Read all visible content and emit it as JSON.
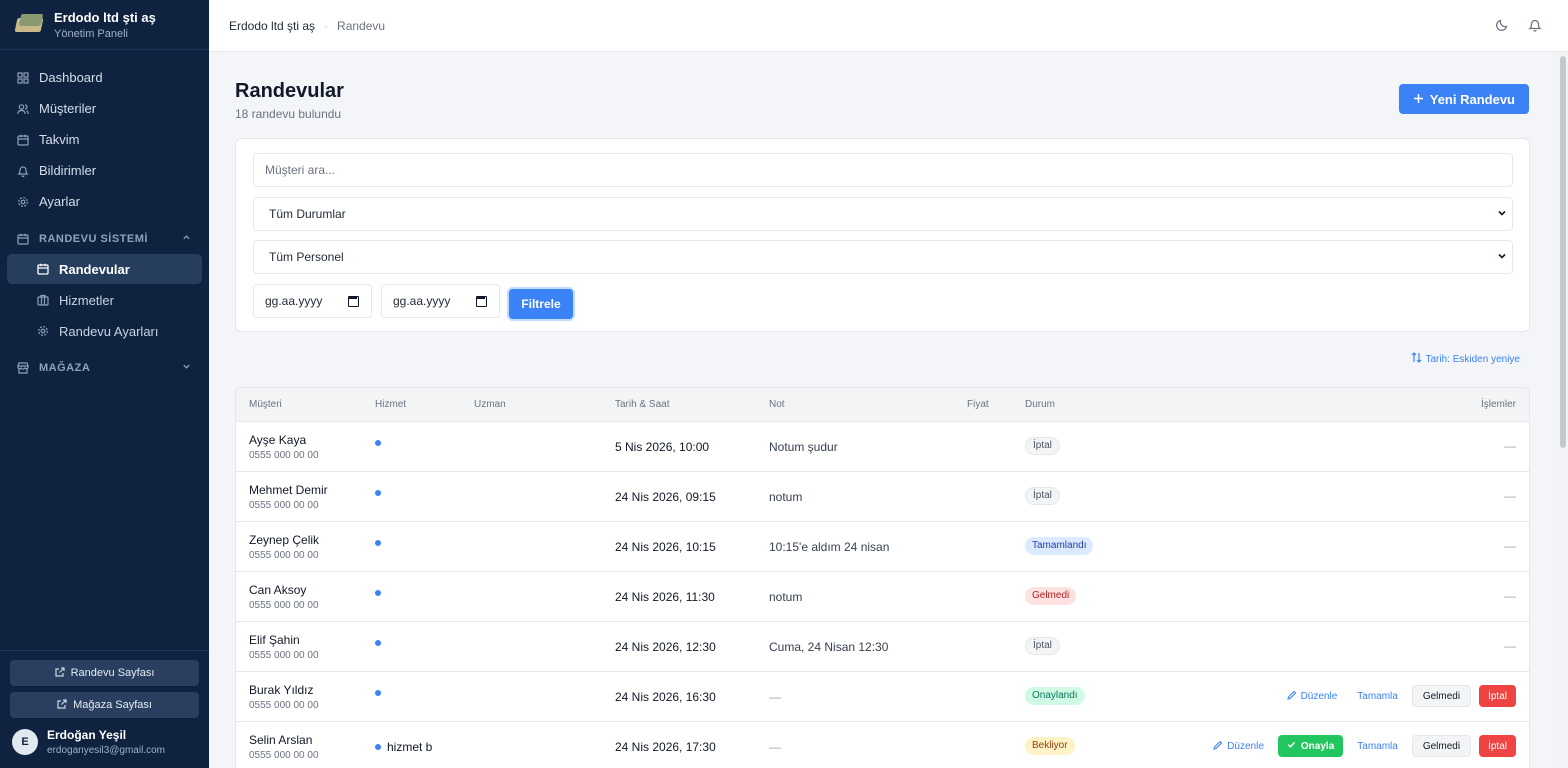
{
  "brand": {
    "name": "Erdodo ltd şti aş",
    "subtitle": "Yönetim Paneli"
  },
  "nav": [
    {
      "label": "Dashboard",
      "icon": "grid-icon"
    },
    {
      "label": "Müşteriler",
      "icon": "users-icon"
    },
    {
      "label": "Takvim",
      "icon": "calendar-icon"
    },
    {
      "label": "Bildirimler",
      "icon": "bell-icon"
    },
    {
      "label": "Ayarlar",
      "icon": "gear-icon"
    }
  ],
  "section_randevu": {
    "label": "RANDEVU SİSTEMİ",
    "items": [
      {
        "label": "Randevular",
        "active": true
      },
      {
        "label": "Hizmetler"
      },
      {
        "label": "Randevu Ayarları"
      }
    ]
  },
  "section_magaza": {
    "label": "MAĞAZA"
  },
  "sidebar_buttons": {
    "randevu_page": "Randevu Sayfası",
    "magaza_page": "Mağaza Sayfası"
  },
  "user": {
    "initial": "E",
    "name": "Erdoğan Yeşil",
    "email": "erdoganyesil3@gmail.com"
  },
  "breadcrumb": {
    "root": "Erdodo ltd şti aş",
    "sep": "·",
    "current": "Randevu"
  },
  "page": {
    "title": "Randevular",
    "subtitle": "18 randevu bulundu",
    "new_button": "Yeni Randevu"
  },
  "filters": {
    "search_placeholder": "Müşteri ara...",
    "status_selected": "Tüm Durumlar",
    "staff_selected": "Tüm Personel",
    "date_from": "gg.aa.yyyy",
    "date_to": "gg.aa.yyyy",
    "filter_button": "Filtrele"
  },
  "sort": {
    "label": "Tarih: Eskiden yeniye"
  },
  "table": {
    "headers": {
      "customer": "Müşteri",
      "service": "Hizmet",
      "expert": "Uzman",
      "datetime": "Tarih & Saat",
      "note": "Not",
      "price": "Fiyat",
      "status": "Durum",
      "actions": "İşlemler"
    },
    "rows": [
      {
        "name": "Ayşe Kaya",
        "phone": "0555 000 00 00",
        "service": "",
        "datetime": "5 Nis 2026, 10:00",
        "note": "Notum şudur",
        "status": "İptal",
        "action_text": "—"
      },
      {
        "name": "Mehmet Demir",
        "phone": "0555 000 00 00",
        "service": "",
        "datetime": "24 Nis 2026, 09:15",
        "note": "notum",
        "status": "İptal",
        "action_text": "—"
      },
      {
        "name": "Zeynep Çelik",
        "phone": "0555 000 00 00",
        "service": "",
        "datetime": "24 Nis 2026, 10:15",
        "note": "10:15'e aldım 24 nisan",
        "status": "Tamamlandı",
        "action_text": "—"
      },
      {
        "name": "Can Aksoy",
        "phone": "0555 000 00 00",
        "service": "",
        "datetime": "24 Nis 2026, 11:30",
        "note": "notum",
        "status": "Gelmedi",
        "action_text": "—"
      },
      {
        "name": "Elif Şahin",
        "phone": "0555 000 00 00",
        "service": "",
        "datetime": "24 Nis 2026, 12:30",
        "note": "Cuma, 24 Nisan 12:30",
        "status": "İptal",
        "action_text": "—"
      },
      {
        "name": "Burak Yıldız",
        "phone": "0555 000 00 00",
        "service": "",
        "datetime": "24 Nis 2026, 16:30",
        "note": "—",
        "status": "Onaylandı"
      },
      {
        "name": "Selin Arslan",
        "phone": "0555 000 00 00",
        "service": "hizmet b",
        "datetime": "24 Nis 2026, 17:30",
        "note": "—",
        "status": "Bekliyor"
      }
    ]
  },
  "actions": {
    "edit": "Düzenle",
    "approve": "Onayla",
    "complete": "Tamamla",
    "noshow": "Gelmedi",
    "cancel": "İptal"
  },
  "colors": {
    "sidebar_bg": "#0f2340",
    "accent": "#3b82f6",
    "danger": "#ef4444",
    "success": "#22c55e"
  }
}
